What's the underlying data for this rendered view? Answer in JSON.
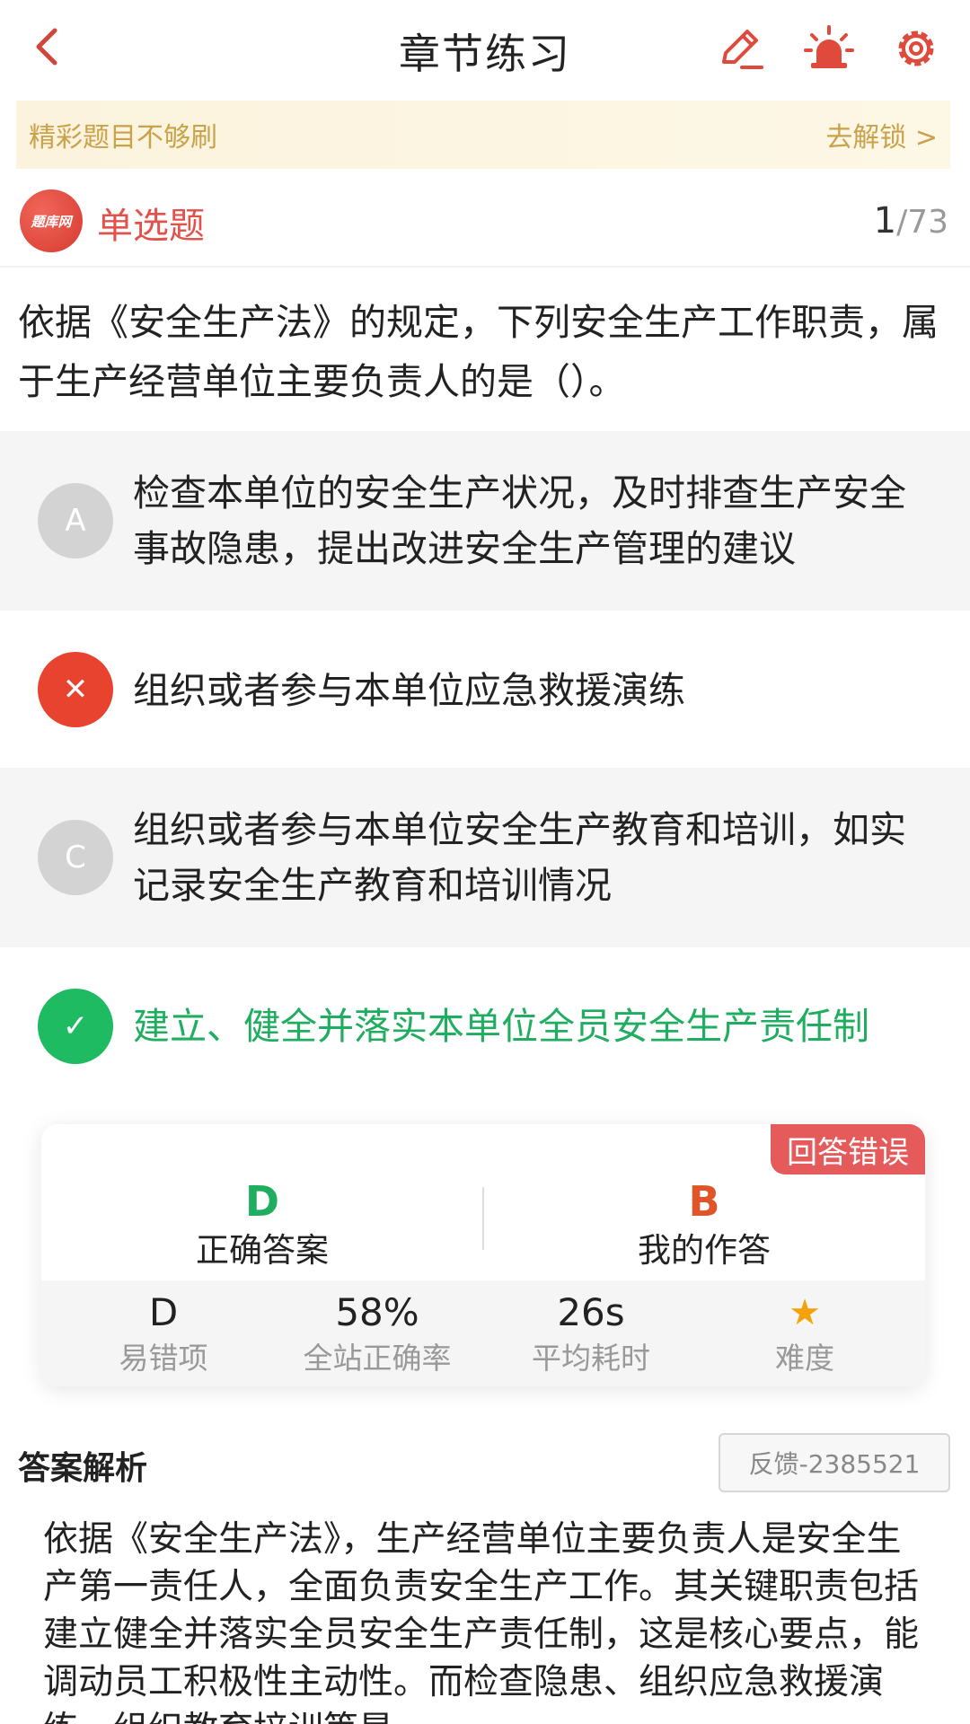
{
  "header": {
    "title": "章节练习",
    "icons": [
      "back-chevron-icon",
      "edit-pen-icon",
      "alarm-light-icon",
      "gear-icon"
    ]
  },
  "banner": {
    "text": "精彩题目不够刷",
    "link": "去解锁 >"
  },
  "question": {
    "logo_text": "题库网",
    "type": "单选题",
    "current": "1",
    "total": "/73",
    "stem": "依据《安全生产法》的规定，下列安全生产工作职责，属于生产经营单位主要负责人的是（）。",
    "options": [
      {
        "marker": "A",
        "state": "normal",
        "text": "检查本单位的安全生产状况，及时排查生产安全事故隐患，提出改进安全生产管理的建议"
      },
      {
        "marker": "✕",
        "state": "wrong",
        "text": "组织或者参与本单位应急救援演练"
      },
      {
        "marker": "C",
        "state": "normal",
        "text": "组织或者参与本单位安全生产教育和培训，如实记录安全生产教育和培训情况"
      },
      {
        "marker": "✓",
        "state": "correct",
        "text": "建立、健全并落实本单位全员安全生产责任制"
      }
    ]
  },
  "result": {
    "badge": "回答错误",
    "correct_answer": "D",
    "correct_label": "正确答案",
    "my_answer": "B",
    "my_label": "我的作答",
    "stats": [
      {
        "value": "D",
        "label": "易错项"
      },
      {
        "value": "58%",
        "label": "全站正确率"
      },
      {
        "value": "26s",
        "label": "平均耗时"
      },
      {
        "value": "★",
        "label": "难度",
        "stars": 1
      }
    ],
    "colors": {
      "correct": "#1fae5f",
      "wrong": "#e0542a",
      "badge": "#e55a5a"
    }
  },
  "analysis": {
    "title": "答案解析",
    "feedback": "反馈-2385521",
    "text": "依据《安全生产法》，生产经营单位主要负责人是安全生产第一责任人，全面负责安全生产工作。其关键职责包括建立健全并落实全员安全生产责任制，这是核心要点，能调动员工积极性主动性。而检查隐患、组织应急救援演练、组织教育培训等是"
  }
}
